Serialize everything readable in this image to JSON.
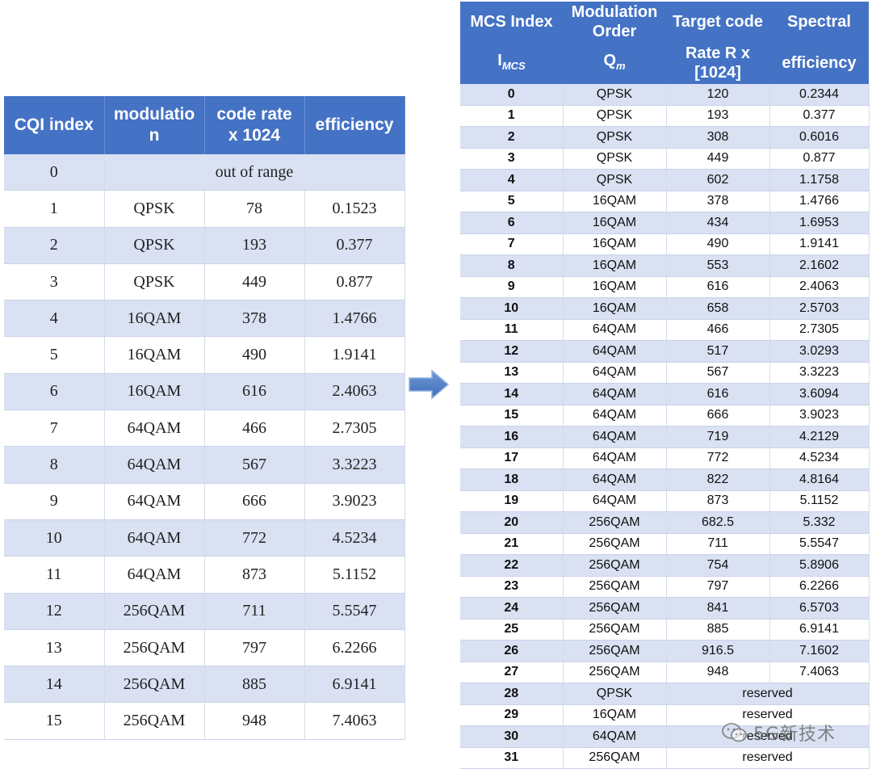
{
  "cqi_table": {
    "headers": [
      "CQI index",
      "modulatio\nn",
      "code rate\nx 1024",
      "efficiency"
    ],
    "out_of_range_row": {
      "index": "0",
      "text": "out of range"
    },
    "rows": [
      [
        "1",
        "QPSK",
        "78",
        "0.1523"
      ],
      [
        "2",
        "QPSK",
        "193",
        "0.377"
      ],
      [
        "3",
        "QPSK",
        "449",
        "0.877"
      ],
      [
        "4",
        "16QAM",
        "378",
        "1.4766"
      ],
      [
        "5",
        "16QAM",
        "490",
        "1.9141"
      ],
      [
        "6",
        "16QAM",
        "616",
        "2.4063"
      ],
      [
        "7",
        "64QAM",
        "466",
        "2.7305"
      ],
      [
        "8",
        "64QAM",
        "567",
        "3.3223"
      ],
      [
        "9",
        "64QAM",
        "666",
        "3.9023"
      ],
      [
        "10",
        "64QAM",
        "772",
        "4.5234"
      ],
      [
        "11",
        "64QAM",
        "873",
        "5.1152"
      ],
      [
        "12",
        "256QAM",
        "711",
        "5.5547"
      ],
      [
        "13",
        "256QAM",
        "797",
        "6.2266"
      ],
      [
        "14",
        "256QAM",
        "885",
        "6.9141"
      ],
      [
        "15",
        "256QAM",
        "948",
        "7.4063"
      ]
    ]
  },
  "mcs_table": {
    "header_top": [
      "MCS Index",
      "Modulation\nOrder",
      "Target code",
      "Spectral"
    ],
    "header_bottom": {
      "mcs_symbol": "I",
      "mcs_sub": "MCS",
      "mod_symbol": "Q",
      "mod_sub": "m",
      "rate": "Rate R x\n[1024]",
      "efficiency": "efficiency"
    },
    "rows": [
      [
        "0",
        "QPSK",
        "120",
        "0.2344"
      ],
      [
        "1",
        "QPSK",
        "193",
        "0.377"
      ],
      [
        "2",
        "QPSK",
        "308",
        "0.6016"
      ],
      [
        "3",
        "QPSK",
        "449",
        "0.877"
      ],
      [
        "4",
        "QPSK",
        "602",
        "1.1758"
      ],
      [
        "5",
        "16QAM",
        "378",
        "1.4766"
      ],
      [
        "6",
        "16QAM",
        "434",
        "1.6953"
      ],
      [
        "7",
        "16QAM",
        "490",
        "1.9141"
      ],
      [
        "8",
        "16QAM",
        "553",
        "2.1602"
      ],
      [
        "9",
        "16QAM",
        "616",
        "2.4063"
      ],
      [
        "10",
        "16QAM",
        "658",
        "2.5703"
      ],
      [
        "11",
        "64QAM",
        "466",
        "2.7305"
      ],
      [
        "12",
        "64QAM",
        "517",
        "3.0293"
      ],
      [
        "13",
        "64QAM",
        "567",
        "3.3223"
      ],
      [
        "14",
        "64QAM",
        "616",
        "3.6094"
      ],
      [
        "15",
        "64QAM",
        "666",
        "3.9023"
      ],
      [
        "16",
        "64QAM",
        "719",
        "4.2129"
      ],
      [
        "17",
        "64QAM",
        "772",
        "4.5234"
      ],
      [
        "18",
        "64QAM",
        "822",
        "4.8164"
      ],
      [
        "19",
        "64QAM",
        "873",
        "5.1152"
      ],
      [
        "20",
        "256QAM",
        "682.5",
        "5.332"
      ],
      [
        "21",
        "256QAM",
        "711",
        "5.5547"
      ],
      [
        "22",
        "256QAM",
        "754",
        "5.8906"
      ],
      [
        "23",
        "256QAM",
        "797",
        "6.2266"
      ],
      [
        "24",
        "256QAM",
        "841",
        "6.5703"
      ],
      [
        "25",
        "256QAM",
        "885",
        "6.9141"
      ],
      [
        "26",
        "256QAM",
        "916.5",
        "7.1602"
      ],
      [
        "27",
        "256QAM",
        "948",
        "7.4063"
      ]
    ],
    "reserved_rows": [
      [
        "28",
        "QPSK",
        "reserved"
      ],
      [
        "29",
        "16QAM",
        "reserved"
      ],
      [
        "30",
        "64QAM",
        "reserved"
      ],
      [
        "31",
        "256QAM",
        "reserved"
      ]
    ]
  },
  "watermark": {
    "text": "5G新技术"
  },
  "colors": {
    "header_bg": "#4472c4",
    "band_row": "#d9e1f2",
    "arrow": "#4a7ac0"
  },
  "icons": {
    "arrow": "right-arrow-icon",
    "watermark": "wechat-icon"
  }
}
